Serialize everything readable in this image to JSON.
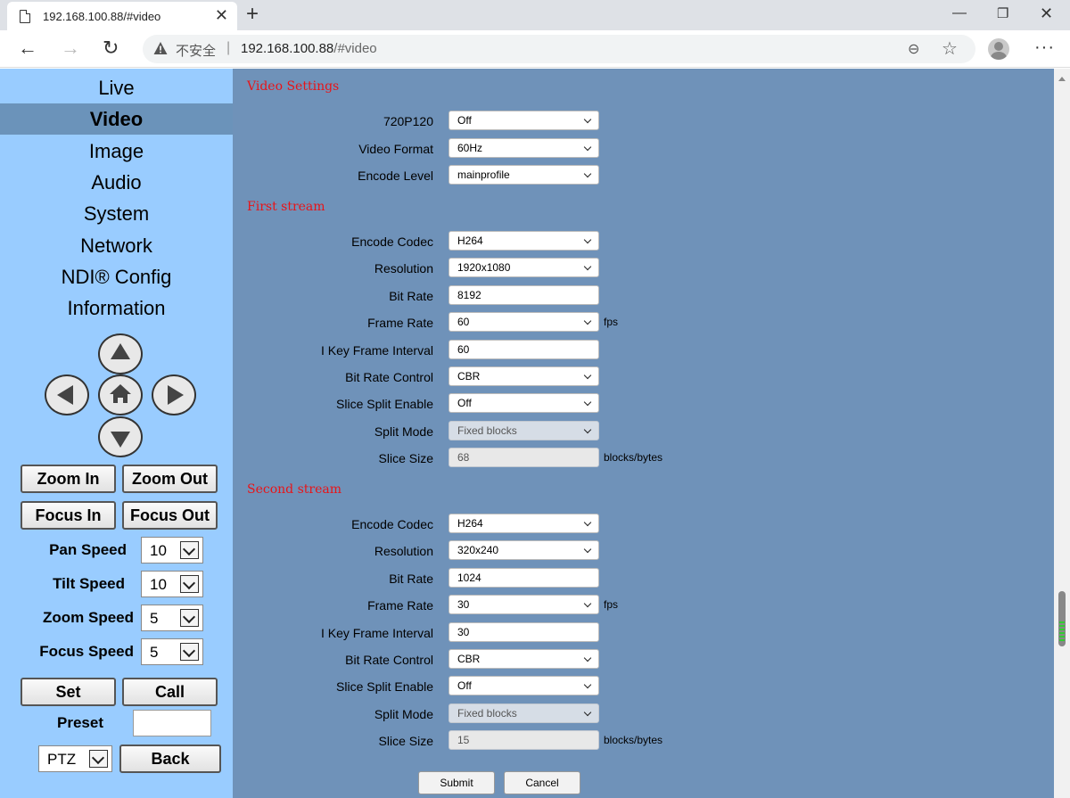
{
  "browser": {
    "tab_title": "192.168.100.88/#video",
    "security_label": "不安全",
    "separator": "|",
    "url_host": "192.168.100.88",
    "url_path": "/#video"
  },
  "sidebar": {
    "menu": [
      "Live",
      "Video",
      "Image",
      "Audio",
      "System",
      "Network",
      "NDI® Config",
      "Information"
    ],
    "active": "Video",
    "buttons": {
      "zoom_in": "Zoom In",
      "zoom_out": "Zoom Out",
      "focus_in": "Focus In",
      "focus_out": "Focus Out",
      "set": "Set",
      "call": "Call",
      "back": "Back"
    },
    "speeds": [
      {
        "label": "Pan Speed",
        "value": "10"
      },
      {
        "label": "Tilt Speed",
        "value": "10"
      },
      {
        "label": "Zoom Speed",
        "value": "5"
      },
      {
        "label": "Focus Speed",
        "value": "5"
      }
    ],
    "preset_label": "Preset",
    "preset_value": "",
    "mode": "PTZ"
  },
  "video_settings": {
    "title": "Video Settings",
    "fields": [
      {
        "label": "720P120",
        "value": "Off",
        "type": "select"
      },
      {
        "label": "Video Format",
        "value": "60Hz",
        "type": "select"
      },
      {
        "label": "Encode Level",
        "value": "mainprofile",
        "type": "select"
      }
    ]
  },
  "first_stream": {
    "title": "First stream",
    "fields": [
      {
        "label": "Encode Codec",
        "value": "H264",
        "type": "select"
      },
      {
        "label": "Resolution",
        "value": "1920x1080",
        "type": "select"
      },
      {
        "label": "Bit Rate",
        "value": "8192",
        "type": "input"
      },
      {
        "label": "Frame Rate",
        "value": "60",
        "type": "select",
        "unit": "fps"
      },
      {
        "label": "I Key Frame Interval",
        "value": "60",
        "type": "input"
      },
      {
        "label": "Bit Rate Control",
        "value": "CBR",
        "type": "select"
      },
      {
        "label": "Slice Split Enable",
        "value": "Off",
        "type": "select"
      },
      {
        "label": "Split Mode",
        "value": "Fixed blocks",
        "type": "select",
        "disabled": true
      },
      {
        "label": "Slice Size",
        "value": "68",
        "type": "input",
        "disabled": true,
        "unit": "blocks/bytes"
      }
    ]
  },
  "second_stream": {
    "title": "Second stream",
    "fields": [
      {
        "label": "Encode Codec",
        "value": "H264",
        "type": "select"
      },
      {
        "label": "Resolution",
        "value": "320x240",
        "type": "select"
      },
      {
        "label": "Bit Rate",
        "value": "1024",
        "type": "input"
      },
      {
        "label": "Frame Rate",
        "value": "30",
        "type": "select",
        "unit": "fps"
      },
      {
        "label": "I Key Frame Interval",
        "value": "30",
        "type": "input"
      },
      {
        "label": "Bit Rate Control",
        "value": "CBR",
        "type": "select"
      },
      {
        "label": "Slice Split Enable",
        "value": "Off",
        "type": "select"
      },
      {
        "label": "Split Mode",
        "value": "Fixed blocks",
        "type": "select",
        "disabled": true
      },
      {
        "label": "Slice Size",
        "value": "15",
        "type": "input",
        "disabled": true,
        "unit": "blocks/bytes"
      }
    ]
  },
  "actions": {
    "submit": "Submit",
    "cancel": "Cancel"
  }
}
